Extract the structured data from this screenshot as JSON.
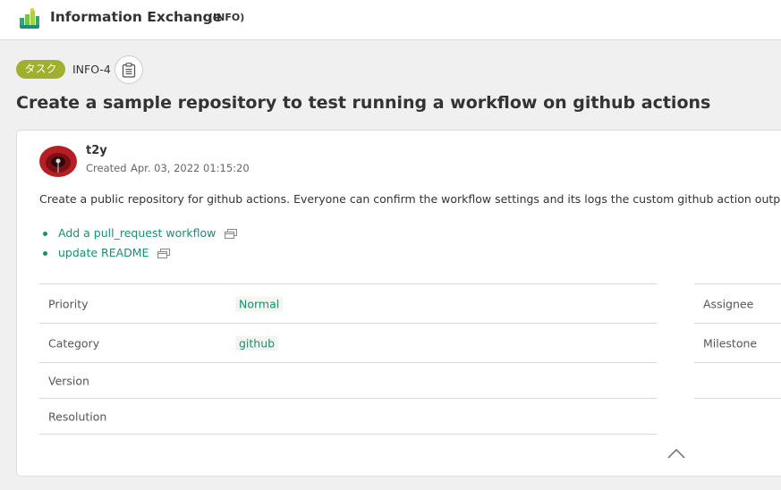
{
  "header": {
    "project_name": "Information Exchange",
    "project_key": "(INFO)",
    "logo_icon": "project-logo-icon"
  },
  "issue": {
    "type": "タスク",
    "type_color": "#a1af2f",
    "key": "INFO-4",
    "title": "Create a sample repository to test running a workflow on github actions",
    "author": "t2y",
    "created_label": "Created",
    "created_date": "Apr. 03, 2022 01:15:20",
    "description": "Create a public repository for github actions. Everyone can confirm the workflow settings and its logs the custom github action outputs.",
    "child_issues": [
      {
        "label": "Add a pull_request workflow",
        "icon": "open-window-icon"
      },
      {
        "label": "update README",
        "icon": "open-window-icon"
      }
    ]
  },
  "properties": {
    "left": [
      {
        "label": "Priority",
        "value": "Normal"
      },
      {
        "label": "Category",
        "value": "github"
      },
      {
        "label": "Version",
        "value": ""
      },
      {
        "label": "Resolution",
        "value": ""
      }
    ],
    "right": [
      {
        "label": "Assignee",
        "value": ""
      },
      {
        "label": "Milestone",
        "value": ""
      },
      {
        "label": "",
        "value": ""
      }
    ]
  },
  "colors": {
    "accent": "#1a8e76",
    "badge": "#a1af2f",
    "background": "#f0f0f0"
  }
}
